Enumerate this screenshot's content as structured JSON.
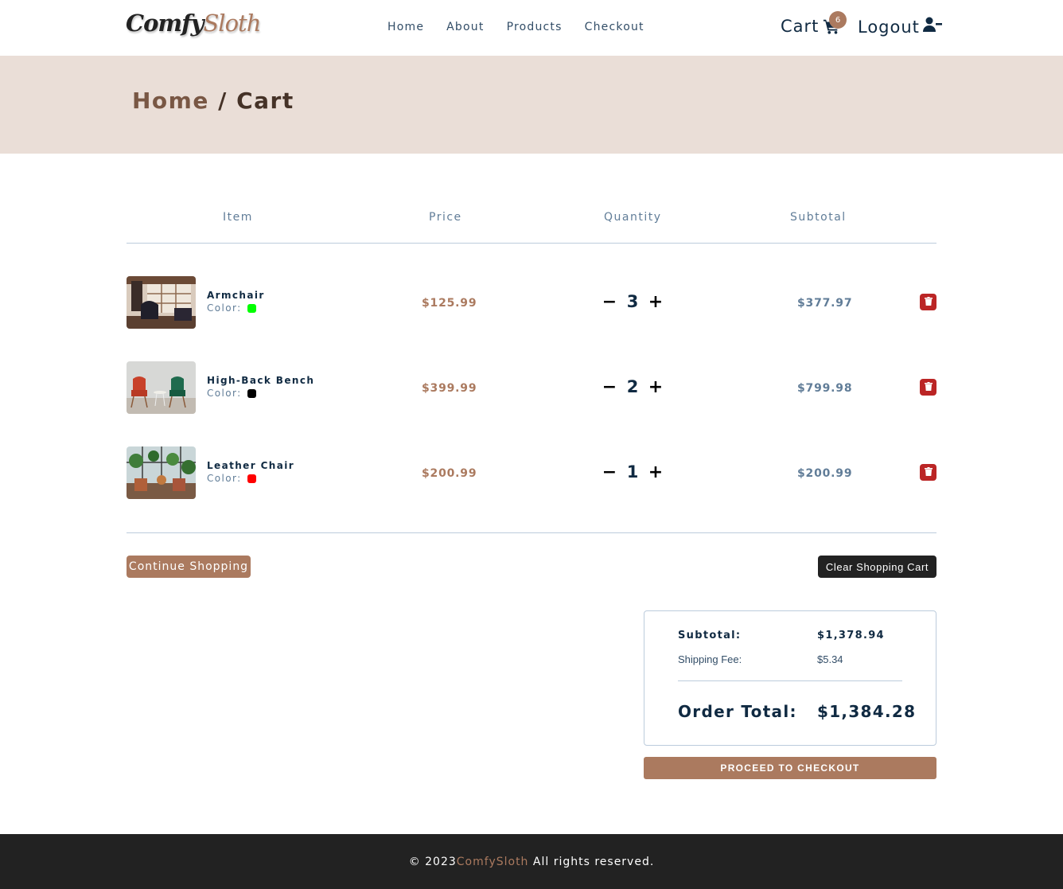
{
  "nav": {
    "logo_part1": "Comfy",
    "logo_part2": "Sloth",
    "links": [
      "Home",
      "About",
      "Products",
      "Checkout"
    ],
    "cart_label": "Cart",
    "cart_count": "6",
    "logout_label": "Logout"
  },
  "hero": {
    "crumb_home": "Home",
    "separator": " / ",
    "crumb_current": "Cart"
  },
  "columns": {
    "item": "Item",
    "price": "Price",
    "quantity": "Quantity",
    "subtotal": "Subtotal"
  },
  "items": [
    {
      "name": "Armchair",
      "color_label": "Color:",
      "color": "#00ff00",
      "price": "$125.99",
      "quantity": "3",
      "subtotal": "$377.97"
    },
    {
      "name": "High-Back Bench",
      "color_label": "Color:",
      "color": "#000000",
      "price": "$399.99",
      "quantity": "2",
      "subtotal": "$799.98"
    },
    {
      "name": "Leather Chair",
      "color_label": "Color:",
      "color": "#ff0000",
      "price": "$200.99",
      "quantity": "1",
      "subtotal": "$200.99"
    }
  ],
  "buttons": {
    "continue": "Continue Shopping",
    "clear": "Clear Shopping Cart",
    "checkout": "PROCEED TO CHECKOUT",
    "decrease": "−",
    "increase": "+"
  },
  "totals": {
    "subtotal_label": "Subtotal:",
    "subtotal_value": "$1,378.94",
    "shipping_label": "Shipping Fee:",
    "shipping_value": "$5.34",
    "order_label": "Order Total:",
    "order_value": "$1,384.28"
  },
  "footer": {
    "prefix": "© 2023",
    "brand": "ComfySloth",
    "suffix": " All rights reserved."
  },
  "colors": {
    "accent": "#ab7a5f",
    "hero_bg": "#eaded7",
    "danger": "#bb2525",
    "dark": "#222222"
  }
}
